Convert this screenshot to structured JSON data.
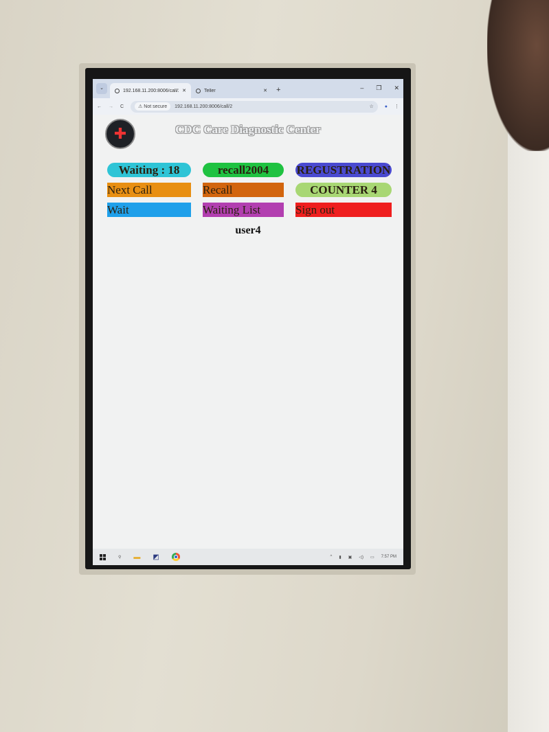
{
  "browser": {
    "tabs": [
      {
        "label": "192.168.11.200:8006/call/2",
        "active": true
      },
      {
        "label": "Teller",
        "active": false
      }
    ],
    "security_label": "Not secure",
    "url": "192.168.11.200:8006/call/2"
  },
  "page": {
    "title": "CDC Care Diagnostic Center",
    "buttons": [
      {
        "label": "Waiting : 18",
        "color": "#2ec4d6",
        "shape": "pill"
      },
      {
        "label": "recall2004",
        "color": "#1fc241",
        "shape": "pill"
      },
      {
        "label": "REGUSTRATION",
        "color": "#4a4ad0",
        "shape": "pill"
      },
      {
        "label": "Next Call",
        "color": "#e88f12",
        "shape": "rect"
      },
      {
        "label": "Recall",
        "color": "#d2650e",
        "shape": "rect"
      },
      {
        "label": "COUNTER 4",
        "color": "#a8d774",
        "shape": "pill"
      },
      {
        "label": "Wait",
        "color": "#1fa0ea",
        "shape": "rect"
      },
      {
        "label": "Waiting List",
        "color": "#b23fb0",
        "shape": "rect"
      },
      {
        "label": "Sign out",
        "color": "#ef1f1f",
        "shape": "rect"
      }
    ],
    "user": "user4"
  },
  "taskbar": {
    "time": "7:57 PM"
  }
}
